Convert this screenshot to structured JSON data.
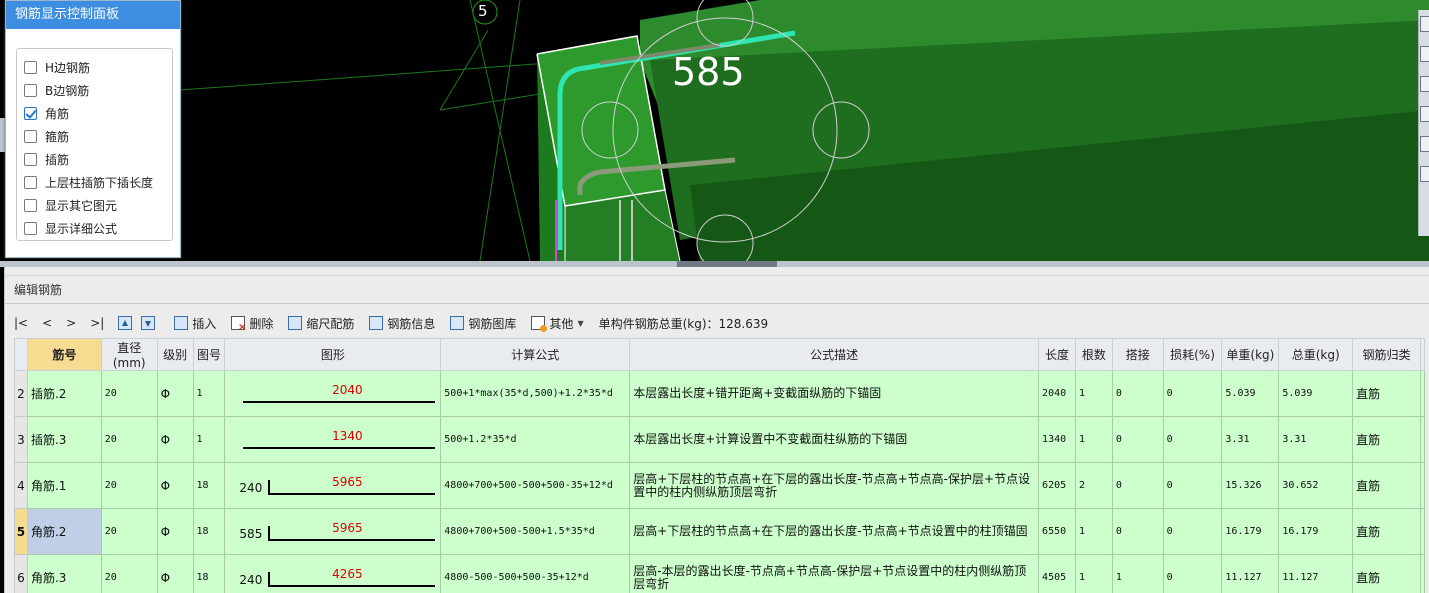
{
  "viewport": {
    "axis_label": "5",
    "dimension_label": "585"
  },
  "panel": {
    "title": "钢筋显示控制面板",
    "options": [
      {
        "label": "H边钢筋",
        "checked": false
      },
      {
        "label": "B边钢筋",
        "checked": false
      },
      {
        "label": "角筋",
        "checked": true
      },
      {
        "label": "箍筋",
        "checked": false
      },
      {
        "label": "插筋",
        "checked": false
      },
      {
        "label": "上层柱插筋下插长度",
        "checked": false
      },
      {
        "label": "显示其它图元",
        "checked": false
      },
      {
        "label": "显示详细公式",
        "checked": false
      }
    ]
  },
  "editor": {
    "title": "编辑钢筋",
    "toolbar": {
      "nav_first": "|<",
      "nav_prev": "<",
      "nav_next": ">",
      "nav_last": ">|",
      "insert": "插入",
      "delete": "删除",
      "scale": "缩尺配筋",
      "info": "钢筋信息",
      "library": "钢筋图库",
      "other": "其他",
      "total_weight": "单构件钢筋总重(kg)：128.639"
    },
    "columns": [
      "筋号",
      "直径(mm)",
      "级别",
      "图号",
      "图形",
      "计算公式",
      "公式描述",
      "长度",
      "根数",
      "搭接",
      "损耗(%)",
      "单重(kg)",
      "总重(kg)",
      "钢筋归类"
    ],
    "rows": [
      {
        "rownum": "2",
        "name": "插筋.2",
        "dia": "20",
        "grade": "Φ",
        "fig": "1",
        "shape_left": "",
        "shape_value": "2040",
        "formula": "500+1*max(35*d,500)+1.2*35*d",
        "desc": "本层露出长度+错开距离+变截面纵筋的下锚固",
        "length": "2040",
        "count": "1",
        "lap": "0",
        "loss": "0",
        "unit_w": "5.039",
        "total_w": "5.039",
        "category": "直筋"
      },
      {
        "rownum": "3",
        "name": "插筋.3",
        "dia": "20",
        "grade": "Φ",
        "fig": "1",
        "shape_left": "",
        "shape_value": "1340",
        "formula": "500+1.2*35*d",
        "desc": "本层露出长度+计算设置中不变截面柱纵筋的下锚固",
        "length": "1340",
        "count": "1",
        "lap": "0",
        "loss": "0",
        "unit_w": "3.31",
        "total_w": "3.31",
        "category": "直筋"
      },
      {
        "rownum": "4",
        "name": "角筋.1",
        "dia": "20",
        "grade": "Φ",
        "fig": "18",
        "shape_left": "240",
        "shape_value": "5965",
        "formula": "4800+700+500-500+500-35+12*d",
        "desc": "层高+下层柱的节点高+在下层的露出长度-节点高+节点高-保护层+节点设置中的柱内侧纵筋顶层弯折",
        "length": "6205",
        "count": "2",
        "lap": "0",
        "loss": "0",
        "unit_w": "15.326",
        "total_w": "30.652",
        "category": "直筋"
      },
      {
        "rownum": "5",
        "name": "角筋.2",
        "dia": "20",
        "grade": "Φ",
        "fig": "18",
        "shape_left": "585",
        "shape_value": "5965",
        "formula": "4800+700+500-500+1.5*35*d",
        "desc": "层高+下层柱的节点高+在下层的露出长度-节点高+节点设置中的柱顶锚固",
        "length": "6550",
        "count": "1",
        "lap": "0",
        "loss": "0",
        "unit_w": "16.179",
        "total_w": "16.179",
        "category": "直筋",
        "selected": true
      },
      {
        "rownum": "6",
        "name": "角筋.3",
        "dia": "20",
        "grade": "Φ",
        "fig": "18",
        "shape_left": "240",
        "shape_value": "4265",
        "formula": "4800-500-500+500-35+12*d",
        "desc": "层高-本层的露出长度-节点高+节点高-保护层+节点设置中的柱内侧纵筋顶层弯折",
        "length": "4505",
        "count": "1",
        "lap": "1",
        "loss": "0",
        "unit_w": "11.127",
        "total_w": "11.127",
        "category": "直筋"
      }
    ]
  }
}
